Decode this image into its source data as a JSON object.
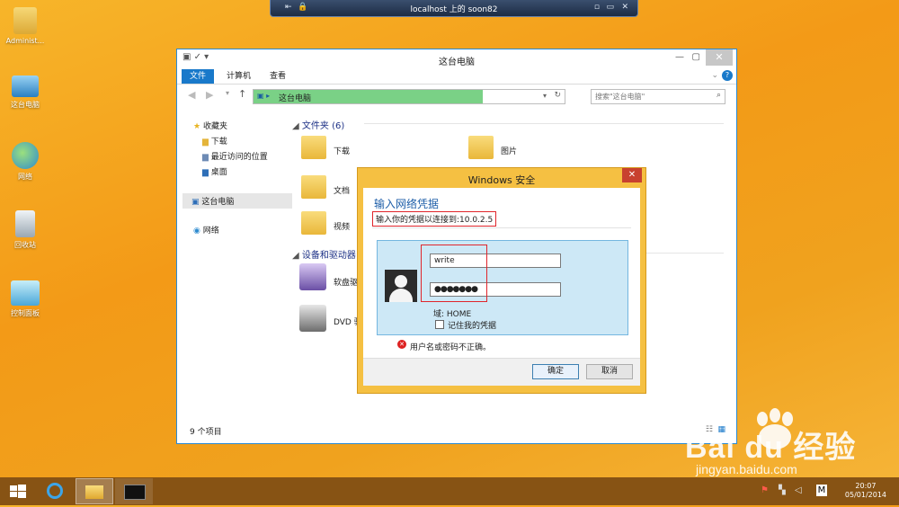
{
  "remote_bar": {
    "title": "localhost 上的 soon82",
    "pin": "⇤",
    "lock": "🔒",
    "minimize": "▫",
    "restore": "▭",
    "close": "✕"
  },
  "desktop": {
    "icons": [
      {
        "label": "Administ..."
      },
      {
        "label": "这台电脑"
      },
      {
        "label": "网络"
      },
      {
        "label": "回收站"
      },
      {
        "label": "控制面板"
      }
    ]
  },
  "explorer": {
    "title": "这台电脑",
    "ribbon_tabs": [
      "文件",
      "计算机",
      "查看"
    ],
    "address": "这台电脑",
    "search_placeholder": "搜索\"这台电脑\"",
    "nav": {
      "favorites": "收藏夹",
      "downloads": "下载",
      "recent": "最近访问的位置",
      "desktop": "桌面",
      "this_pc": "这台电脑",
      "network": "网络"
    },
    "group_folders": "文件夹 (6)",
    "folders": [
      "下载",
      "图片",
      "文档",
      "视频"
    ],
    "group_devices": "设备和驱动器",
    "devices": [
      "软盘驱",
      "DVD 驱"
    ],
    "status": "9 个项目"
  },
  "dialog": {
    "title": "Windows 安全",
    "heading": "输入网络凭据",
    "subtitle": "输入你的凭据以连接到:10.0.2.5",
    "username": "write",
    "password": "●●●●●●●",
    "domain": "域: HOME",
    "remember": "记住我的凭据",
    "error": "用户名或密码不正确。",
    "ok": "确定",
    "cancel": "取消"
  },
  "taskbar": {
    "time": "20:07",
    "date": "05/01/2014",
    "ime": "M"
  },
  "watermark": {
    "brand": "Bai du 经验",
    "url": "jingyan.baidu.com"
  }
}
